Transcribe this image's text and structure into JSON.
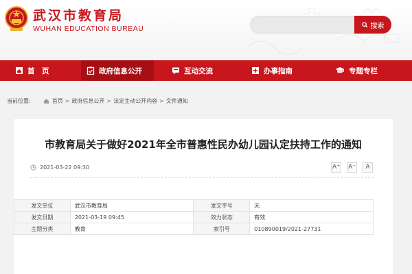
{
  "header": {
    "site_name": "武汉市教育局",
    "site_name_en": "WUHAN EDUCATION BUREAU",
    "search_label": "搜索"
  },
  "nav": {
    "items": [
      {
        "label": "首　页",
        "icon": "home-icon"
      },
      {
        "label": "政府信息公开",
        "icon": "clipboard-check-icon",
        "active": true
      },
      {
        "label": "互动交流",
        "icon": "chat-icon"
      },
      {
        "label": "办事指南",
        "icon": "plus-square-icon"
      },
      {
        "label": "专题专栏",
        "icon": "graduation-cap-icon"
      }
    ]
  },
  "breadcrumb": {
    "prefix": "当前位置:",
    "items": [
      "首页",
      "政府信息公开",
      "法定主动公开内容",
      "文件通知"
    ],
    "separator": ">"
  },
  "article": {
    "title": "市教育局关于做好2021年全市普惠性民办幼儿园认定扶持工作的通知",
    "publish_time": "2021-03-22 09:30",
    "font_buttons": [
      "A⁺",
      "A⁻",
      "A"
    ]
  },
  "info_table": {
    "rows": [
      {
        "k1": "发文单位",
        "v1": "武汉市教育局",
        "k2": "发文字号",
        "v2": "无"
      },
      {
        "k1": "发文日期",
        "v1": "2021-03-19 09:45",
        "k2": "效力状态",
        "v2": "有效"
      },
      {
        "k1": "主题分类",
        "v1": "教育",
        "k2": "索引号",
        "v2": "010890019/2021-27731"
      }
    ]
  },
  "colors": {
    "brand_red": "#c8161d",
    "nav_active": "#a80f15"
  }
}
